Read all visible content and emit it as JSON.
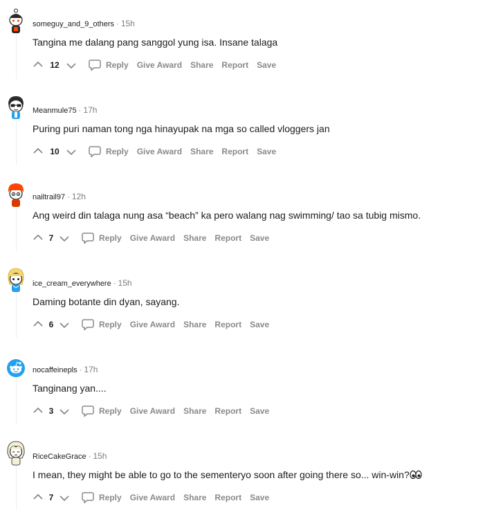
{
  "comments": [
    {
      "username": "someguy_and_9_others",
      "time": "15h",
      "text": "Tangina me dalang pang sanggol yung isa. Insane talaga",
      "score": "12",
      "avatar": "snoo-beanie-avatar"
    },
    {
      "username": "Meanmule75",
      "time": "17h",
      "text": "Puring puri naman tong nga hinayupak na mga so called vloggers jan",
      "score": "10",
      "avatar": "snoo-sunglasses-avatar"
    },
    {
      "username": "nailtrail97",
      "time": "12h",
      "text": "Ang weird din talaga nung asa “beach” ka pero walang nag swimming/ tao sa tubig mismo.",
      "score": "7",
      "avatar": "snoo-orange-hair-avatar"
    },
    {
      "username": "ice_cream_everywhere",
      "time": "15h",
      "text": "Daming botante din dyan, sayang.",
      "score": "6",
      "avatar": "snoo-blonde-avatar"
    },
    {
      "username": "nocaffeinepls",
      "time": "17h",
      "text": "Tanginang yan....",
      "score": "3",
      "avatar": "snoo-default-blue-avatar"
    },
    {
      "username": "RiceCakeGrace",
      "time": "15h",
      "text": "I mean, they might be able to go to the sementeryo soon after going there so... win-win?",
      "score": "7",
      "avatar": "snoo-white-hair-avatar"
    }
  ],
  "separator": "·",
  "actions": {
    "reply": "Reply",
    "give_award": "Give Award",
    "share": "Share",
    "report": "Report",
    "save": "Save"
  },
  "colors": {
    "text": "#1c1c1c",
    "meta": "#7c7c7c",
    "action": "#878a8c",
    "thread_line": "#edeff1",
    "snoo_blue": "#24a0ed",
    "orange": "#ff4500"
  },
  "icons": {
    "upvote": "upvote-arrow-icon",
    "downvote": "downvote-arrow-icon",
    "reply": "speech-bubble-icon",
    "trailing_emoji": "eyes-emoji-icon"
  }
}
